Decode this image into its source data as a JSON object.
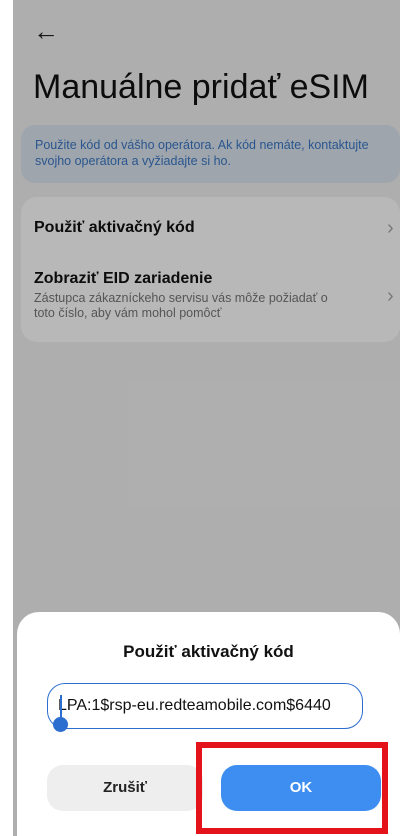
{
  "header": {
    "back_icon": "arrow-left",
    "title": "Manuálne pridať eSIM"
  },
  "info_banner": {
    "text": "Použite kód od vášho operátora. Ak kód nemáte, kontaktujte svojho operátora a vyžiadajte si ho."
  },
  "menu": {
    "items": [
      {
        "label": "Použiť aktivačný kód",
        "sub": ""
      },
      {
        "label": "Zobraziť EID zariadenie",
        "sub": "Zástupca zákazníckeho servisu vás môže požiadať o toto číslo, aby vám mohol pomôcť"
      }
    ],
    "chevron": "›"
  },
  "dialog": {
    "title": "Použiť aktivačný kód",
    "input_value": "LPA:1$rsp-eu.redteamobile.com$6440",
    "cancel_label": "Zrušiť",
    "ok_label": "OK"
  },
  "colors": {
    "accent": "#3d8ef0",
    "highlight": "#e3121b",
    "info_text": "#3a78c6"
  }
}
